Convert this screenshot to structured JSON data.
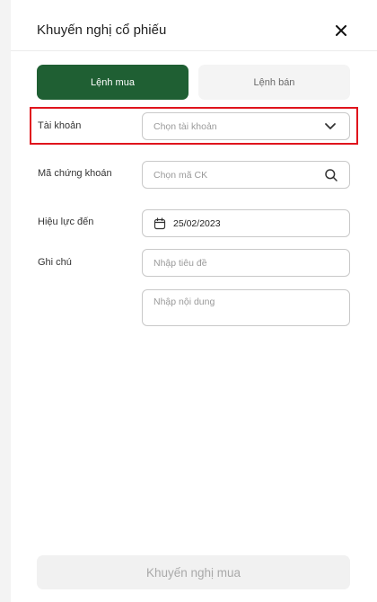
{
  "header": {
    "title": "Khuyến nghị cổ phiếu"
  },
  "tabs": {
    "buy_label": "Lệnh mua",
    "sell_label": "Lệnh bán"
  },
  "form": {
    "account": {
      "label": "Tài khoản",
      "placeholder": "Chọn tài khoản"
    },
    "symbol": {
      "label": "Mã chứng khoán",
      "placeholder": "Chọn mã CK"
    },
    "valid_until": {
      "label": "Hiệu lực đến",
      "value": "25/02/2023"
    },
    "note": {
      "label": "Ghi chú",
      "title_placeholder": "Nhập tiêu đề",
      "content_placeholder": "Nhập nội dung"
    }
  },
  "submit": {
    "label": "Khuyến nghị mua"
  },
  "colors": {
    "primary": "#1f5f33",
    "highlight": "#e0141d"
  }
}
